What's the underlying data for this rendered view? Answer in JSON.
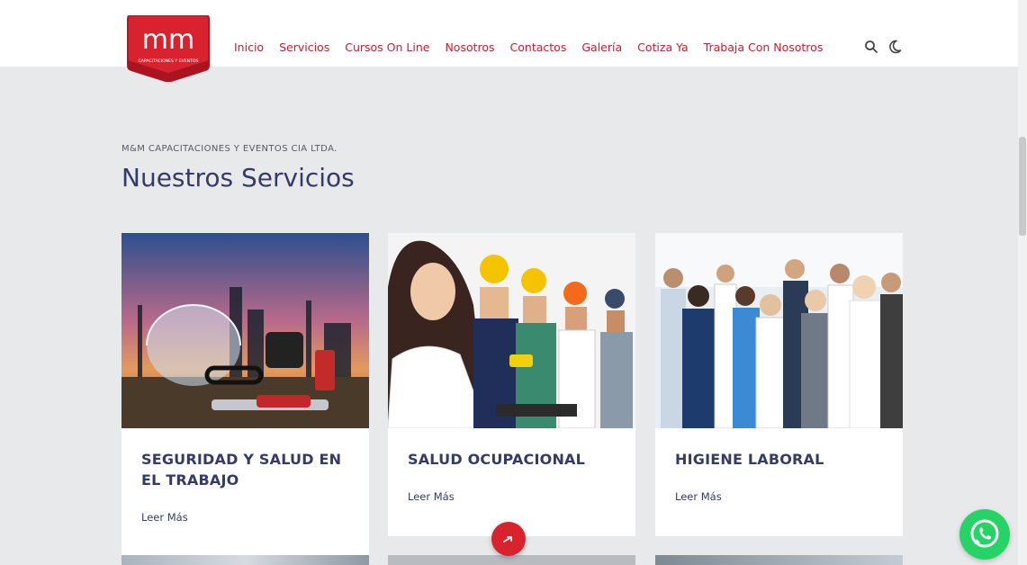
{
  "logo": {
    "mark": "mm",
    "tagline": "CAPACITACIONES Y EVENTOS"
  },
  "nav": [
    {
      "label": "Inicio"
    },
    {
      "label": "Servicios"
    },
    {
      "label": "Cursos On Line"
    },
    {
      "label": "Nosotros"
    },
    {
      "label": "Contactos"
    },
    {
      "label": "Galería"
    },
    {
      "label": "Cotiza Ya"
    },
    {
      "label": "Trabaja Con Nosotros"
    }
  ],
  "icons": {
    "search": "search-icon",
    "theme": "moon-icon",
    "whatsapp": "whatsapp-icon",
    "back_to_top": "arrow-up-icon"
  },
  "section": {
    "kicker": "M&M CAPACITACIONES Y EVENTOS CIA LTDA.",
    "title": "Nuestros Servicios"
  },
  "cards": [
    {
      "title": "SEGURIDAD Y SALUD EN EL TRABAJO",
      "link": "Leer Más"
    },
    {
      "title": "SALUD OCUPACIONAL",
      "link": "Leer Más"
    },
    {
      "title": "HIGIENE LABORAL",
      "link": "Leer Más"
    }
  ],
  "colors": {
    "brand": "#c8202f",
    "heading": "#343b66",
    "page_bg": "#e8e9eb",
    "whatsapp": "#25d366"
  }
}
